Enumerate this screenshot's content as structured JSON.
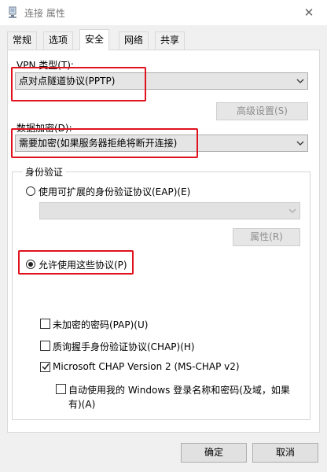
{
  "window": {
    "title": "连接 属性",
    "close_symbol": "✕"
  },
  "tabs": [
    {
      "label": "常规",
      "active": false
    },
    {
      "label": "选项",
      "active": false
    },
    {
      "label": "安全",
      "active": true
    },
    {
      "label": "网络",
      "active": false
    },
    {
      "label": "共享",
      "active": false
    }
  ],
  "vpn": {
    "type_label": "VPN 类型(T):",
    "type_value": "点对点隧道协议(PPTP)",
    "advanced_button": "高级设置(S)"
  },
  "encryption": {
    "label": "数据加密(D):",
    "value": "需要加密(如果服务器拒绝将断开连接)"
  },
  "auth": {
    "group_label": "身份验证",
    "eap_radio_label": "使用可扩展的身份验证协议(EAP)(E)",
    "eap_radio_selected": false,
    "eap_combo_value": "",
    "properties_button": "属性(R)",
    "allow_radio_label": "允许使用这些协议(P)",
    "allow_radio_selected": true,
    "protocols": [
      {
        "label": "未加密的密码(PAP)(U)",
        "checked": false
      },
      {
        "label": "质询握手身份验证协议(CHAP)(H)",
        "checked": false
      },
      {
        "label": "Microsoft CHAP Version 2 (MS-CHAP v2)",
        "checked": true
      }
    ],
    "auto_windows_logon_line1": "自动使用我的 Windows 登录名称和密码(及域，如果",
    "auto_windows_logon_line2": "有)(A)",
    "auto_windows_logon_checked": false
  },
  "footer": {
    "ok_button": "确定",
    "cancel_button": "取消"
  },
  "colors": {
    "highlight": "#e0121e",
    "window_bg": "#f0f0f0",
    "panel_bg": "#ffffff"
  }
}
